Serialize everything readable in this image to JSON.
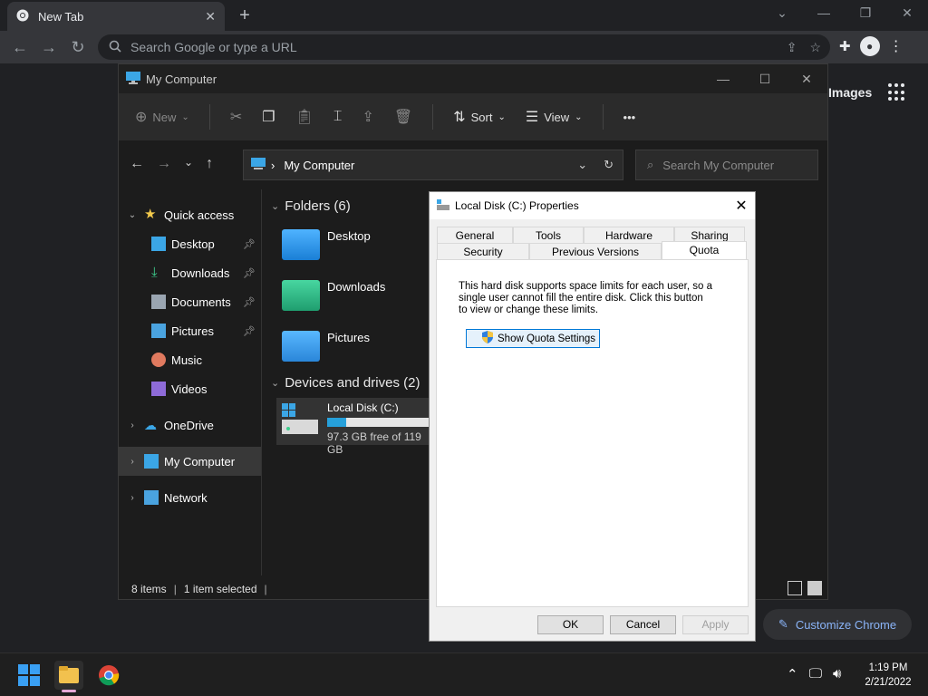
{
  "chrome": {
    "tab_title": "New Tab",
    "omnibox_placeholder": "Search Google or type a URL",
    "ntp_images": "Images",
    "customize_label": "Customize Chrome"
  },
  "explorer": {
    "title": "My Computer",
    "cmd": {
      "new": "New",
      "sort": "Sort",
      "view": "View",
      "more": "•••"
    },
    "address": "My Computer",
    "search_placeholder": "Search My Computer",
    "nav": [
      {
        "label": "Quick access",
        "level": 0,
        "expanded": true
      },
      {
        "label": "Desktop",
        "level": 1,
        "pinned": true
      },
      {
        "label": "Downloads",
        "level": 1,
        "pinned": true
      },
      {
        "label": "Documents",
        "level": 1,
        "pinned": true
      },
      {
        "label": "Pictures",
        "level": 1,
        "pinned": true
      },
      {
        "label": "Music",
        "level": 1
      },
      {
        "label": "Videos",
        "level": 1
      },
      {
        "label": "OneDrive",
        "level": 0
      },
      {
        "label": "My Computer",
        "level": 0,
        "selected": true
      },
      {
        "label": "Network",
        "level": 0
      }
    ],
    "folders_header": "Folders (6)",
    "folders": [
      "Desktop",
      "Downloads",
      "Pictures"
    ],
    "devices_header": "Devices and drives (2)",
    "drive": {
      "name": "Local Disk (C:)",
      "free_text": "97.3 GB free of 119 GB",
      "used_fraction": 0.18
    },
    "status": {
      "items": "8 items",
      "selected": "1 item selected"
    }
  },
  "dialog": {
    "title": "Local Disk (C:) Properties",
    "tabs_row1": [
      "General",
      "Tools",
      "Hardware",
      "Sharing"
    ],
    "tabs_row2": [
      "Security",
      "Previous Versions",
      "Quota"
    ],
    "active_tab": "Quota",
    "description": "This hard disk supports space limits for each user, so a single user cannot fill the entire disk. Click this button to view or change these limits.",
    "quota_button": "Show Quota Settings",
    "ok": "OK",
    "cancel": "Cancel",
    "apply": "Apply"
  },
  "taskbar": {
    "time": "1:19 PM",
    "date": "2/21/2022"
  }
}
